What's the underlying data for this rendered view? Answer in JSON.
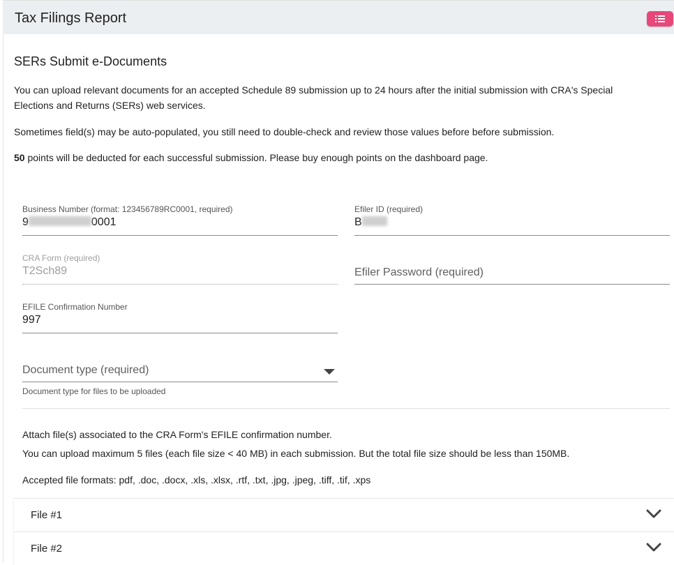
{
  "header": {
    "title": "Tax Filings Report",
    "menu_icon": "list-icon",
    "accent_color": "#e8477a"
  },
  "main": {
    "section_title": "SERs Submit e-Documents",
    "intro_line1": "You can upload relevant documents for an accepted Schedule 89 submission up to 24 hours after the initial submission with CRA's Special",
    "intro_line2": "Elections and Returns (SERs) web services.",
    "note_autopopulate": "Sometimes field(s) may be auto-populated, you still need to double-check and review those values before before submission.",
    "points_amount": "50",
    "points_text": " points will be deducted for each successful submission. Please buy enough points on the dashboard page."
  },
  "form": {
    "business_number": {
      "label": "Business Number (format: 123456789RC0001, required)",
      "value_prefix": "9",
      "value_suffix": "0001"
    },
    "efiler_id": {
      "label": "Efiler ID (required)",
      "value_prefix": "B"
    },
    "cra_form": {
      "label": "CRA Form (required)",
      "value": "T2Sch89"
    },
    "efiler_password": {
      "placeholder": "Efiler Password (required)"
    },
    "efile_confirmation": {
      "label": "EFILE Confirmation Number",
      "value": "997"
    },
    "document_type": {
      "placeholder": "Document type (required)",
      "hint": "Document type for files to be uploaded"
    }
  },
  "attach": {
    "line1": "Attach file(s) associated to the CRA Form's EFILE confirmation number.",
    "line2": "You can upload maximum 5 files (each file size < 40 MB) in each submission. But the total file size should be less than 150MB.",
    "formats": "Accepted file formats: pdf, .doc, .docx, .xls, .xlsx, .rtf, .txt, .jpg, .jpeg, .tiff, .tif, .xps"
  },
  "files": [
    {
      "label": "File #1"
    },
    {
      "label": "File #2"
    }
  ]
}
